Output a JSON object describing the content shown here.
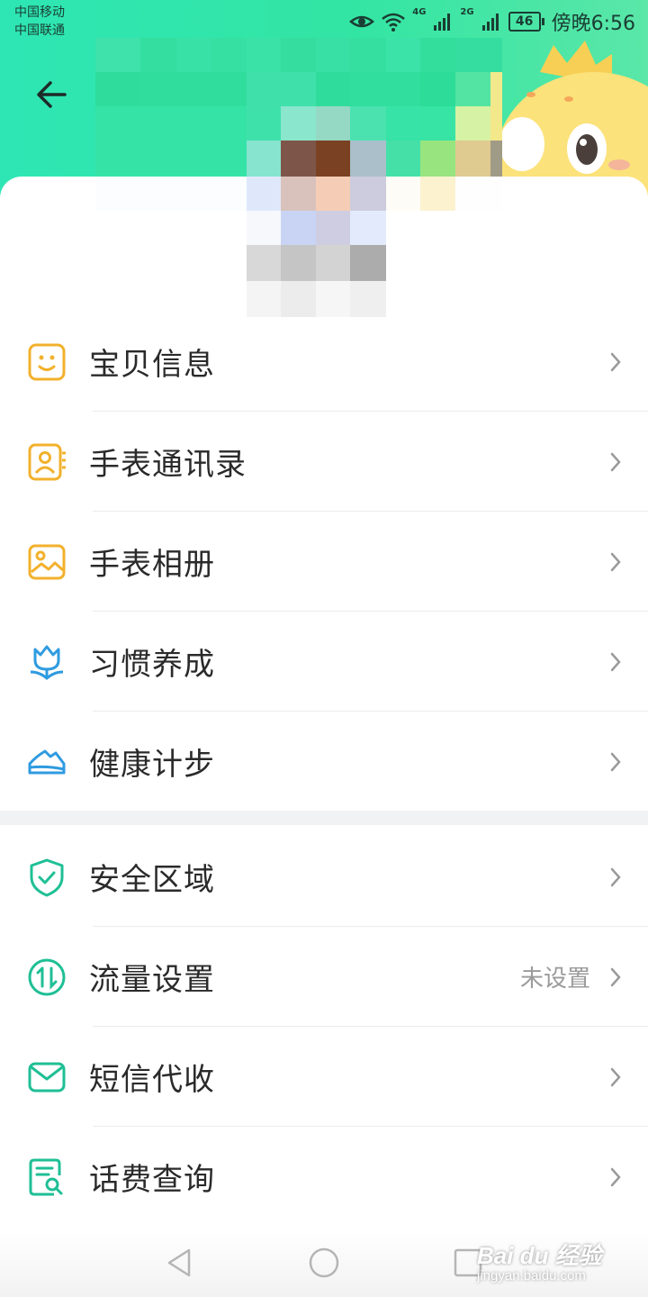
{
  "status_bar": {
    "carrier_1": "中国移动",
    "carrier_2": "中国联通",
    "net_1": "4G",
    "net_2": "2G",
    "battery": "46",
    "time": "傍晚6:56"
  },
  "header": {
    "back_icon": "arrow-left-icon",
    "mascot": "yellow-dinosaur-mascot"
  },
  "menu_group_1": [
    {
      "label": "宝贝信息",
      "icon": "smiley-icon",
      "icon_color": "#f2b12c"
    },
    {
      "label": "手表通讯录",
      "icon": "contact-book-icon",
      "icon_color": "#f2b12c"
    },
    {
      "label": "手表相册",
      "icon": "photo-album-icon",
      "icon_color": "#f2b12c"
    },
    {
      "label": "习惯养成",
      "icon": "tulip-icon",
      "icon_color": "#2f9be0"
    },
    {
      "label": "健康计步",
      "icon": "shoe-icon",
      "icon_color": "#2f9be0"
    }
  ],
  "menu_group_2": [
    {
      "label": "安全区域",
      "icon": "shield-check-icon",
      "icon_color": "#1fbf95",
      "value": ""
    },
    {
      "label": "流量设置",
      "icon": "data-traffic-icon",
      "icon_color": "#1fbf95",
      "value": "未设置"
    },
    {
      "label": "短信代收",
      "icon": "envelope-icon",
      "icon_color": "#1fbf95",
      "value": ""
    },
    {
      "label": "话费查询",
      "icon": "bill-search-icon",
      "icon_color": "#1fbf95",
      "value": ""
    }
  ],
  "nav_bar": {
    "back": "triangle-back-icon",
    "home": "circle-home-icon",
    "recent": "square-recent-icon"
  },
  "watermark": {
    "logo": "Bai du 经验",
    "url": "jingyan.baidu.com"
  },
  "colors": {
    "header_green": "#33e5a3",
    "yellow_icon": "#f2b12c",
    "blue_icon": "#2f9be0",
    "green_icon": "#1fbf95"
  }
}
